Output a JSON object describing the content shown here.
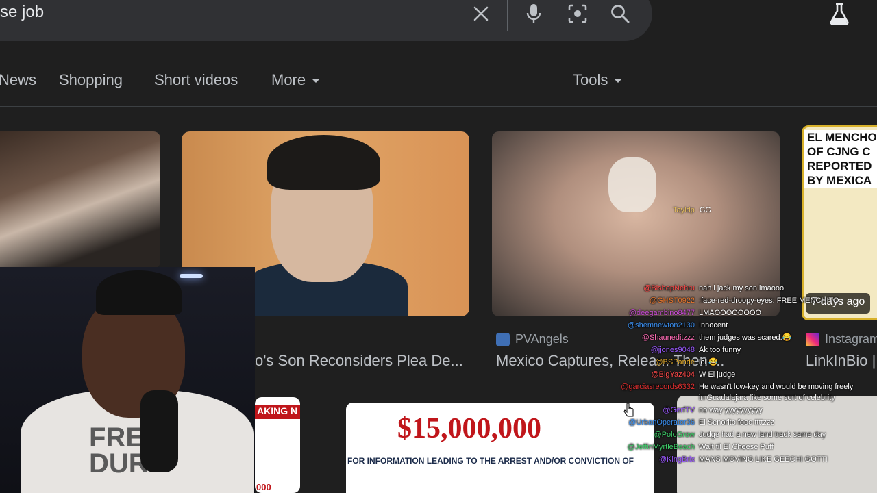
{
  "search": {
    "query_visible": "se job"
  },
  "tabs": [
    {
      "label": "News"
    },
    {
      "label": "Shopping"
    },
    {
      "label": "Short videos"
    },
    {
      "label": "More"
    }
  ],
  "tools_label": "Tools",
  "results": {
    "card2_title": "o's Son Reconsiders Plea De...",
    "card3_source": "PVAngels",
    "card3_title": "Mexico Captures, Relea... Then ...",
    "card4_source": "Instagram",
    "card4_title": "LinkInBio |",
    "card4_image_text": "EL MENCHO\nOF CJNG C\nREPORTED\nBY MEXICA",
    "card4_badge": "7 days ago",
    "card5_header": "AKING N",
    "card5_number": "000",
    "card6_amount": "$15,000,000",
    "card6_sub": "FOR INFORMATION LEADING TO THE ARREST AND/OR CONVICTION OF"
  },
  "webcam": {
    "hoodie_text": "FRE\nDURK"
  },
  "chat": {
    "floating": {
      "user": "Tayldp",
      "msg": "GG"
    },
    "messages": [
      {
        "user": "@BishopNehru",
        "msg": "nah i jack my son lmaooo",
        "color": "#ff4a4a"
      },
      {
        "user": "@GHST0922",
        "msg": ":face-red-droopy-eyes: FREE MENCHITO",
        "color": "#e8772e"
      },
      {
        "user": "@deegambino8477",
        "msg": "LMAOOOOOOOO",
        "color": "#c94bd6"
      },
      {
        "user": "@shemnewton2130",
        "msg": "Innocent",
        "color": "#3b8ff0"
      },
      {
        "user": "@Shauneditzzz",
        "msg": "them judges was scared.😂",
        "color": "#ff6bb5"
      },
      {
        "user": "@jjones9048",
        "msg": "Ak too funny",
        "color": "#9b59ff"
      },
      {
        "user": "@BSPande",
        "msg": "lol 😂",
        "color": "#e8b02e"
      },
      {
        "user": "@BigYaz404",
        "msg": "W El judge",
        "color": "#ff4a4a"
      },
      {
        "user": "@garciasrecords6332",
        "msg": "He wasn't low-key and would be moving freely",
        "color": "#e33030"
      },
      {
        "user": "",
        "msg": "in Guadalajara like some sort of celebrity",
        "color": "#e33030"
      },
      {
        "user": "@GerfTV",
        "msg": "no way yyyyyyyyyy",
        "color": "#9b59ff"
      },
      {
        "user": "@UrbanOperator36",
        "msg": "El Senorito fooo ttttzzz",
        "color": "#3b8ff0"
      },
      {
        "user": "@PoloGrow",
        "msg": "Judge had a new land track same day",
        "color": "#3ecf6a"
      },
      {
        "user": "@JeffinMyrtleBeach",
        "msg": "Wait til El Cheese Puff",
        "color": "#3ecf6a"
      },
      {
        "user": "@KingBrix",
        "msg": "MANS MOVING LIKE GEECHI GOTTI",
        "color": "#9b59ff"
      }
    ]
  }
}
